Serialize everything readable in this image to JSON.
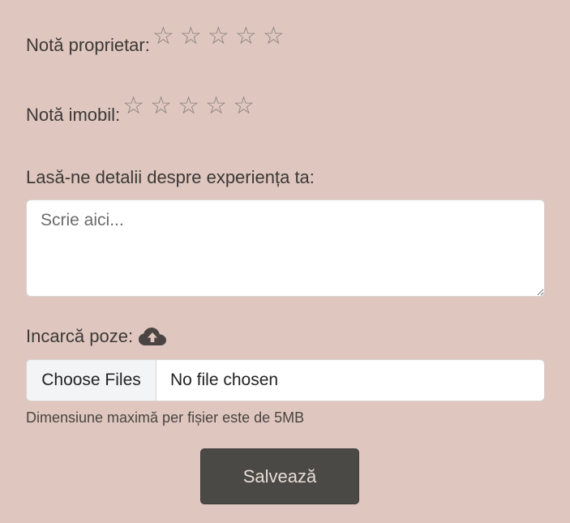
{
  "ratings": {
    "owner": {
      "label": "Notă proprietar:",
      "stars": [
        "☆",
        "☆",
        "☆",
        "☆",
        "☆"
      ],
      "value": 0,
      "max": 5
    },
    "property": {
      "label": "Notă imobil:",
      "stars": [
        "☆",
        "☆",
        "☆",
        "☆",
        "☆"
      ],
      "value": 0,
      "max": 5
    }
  },
  "details": {
    "label": "Lasă-ne detalii despre experiența ta:",
    "placeholder": "Scrie aici...",
    "value": ""
  },
  "upload": {
    "label": "Incarcă poze:",
    "icon": "cloud-upload-icon",
    "button_label": "Choose Files",
    "status": "No file chosen",
    "hint": "Dimensiune maximă per fișier este de 5MB"
  },
  "submit": {
    "label": "Salvează"
  },
  "colors": {
    "background": "#dfc7bf",
    "button": "#4b4946",
    "star": "#8a7f7b"
  }
}
